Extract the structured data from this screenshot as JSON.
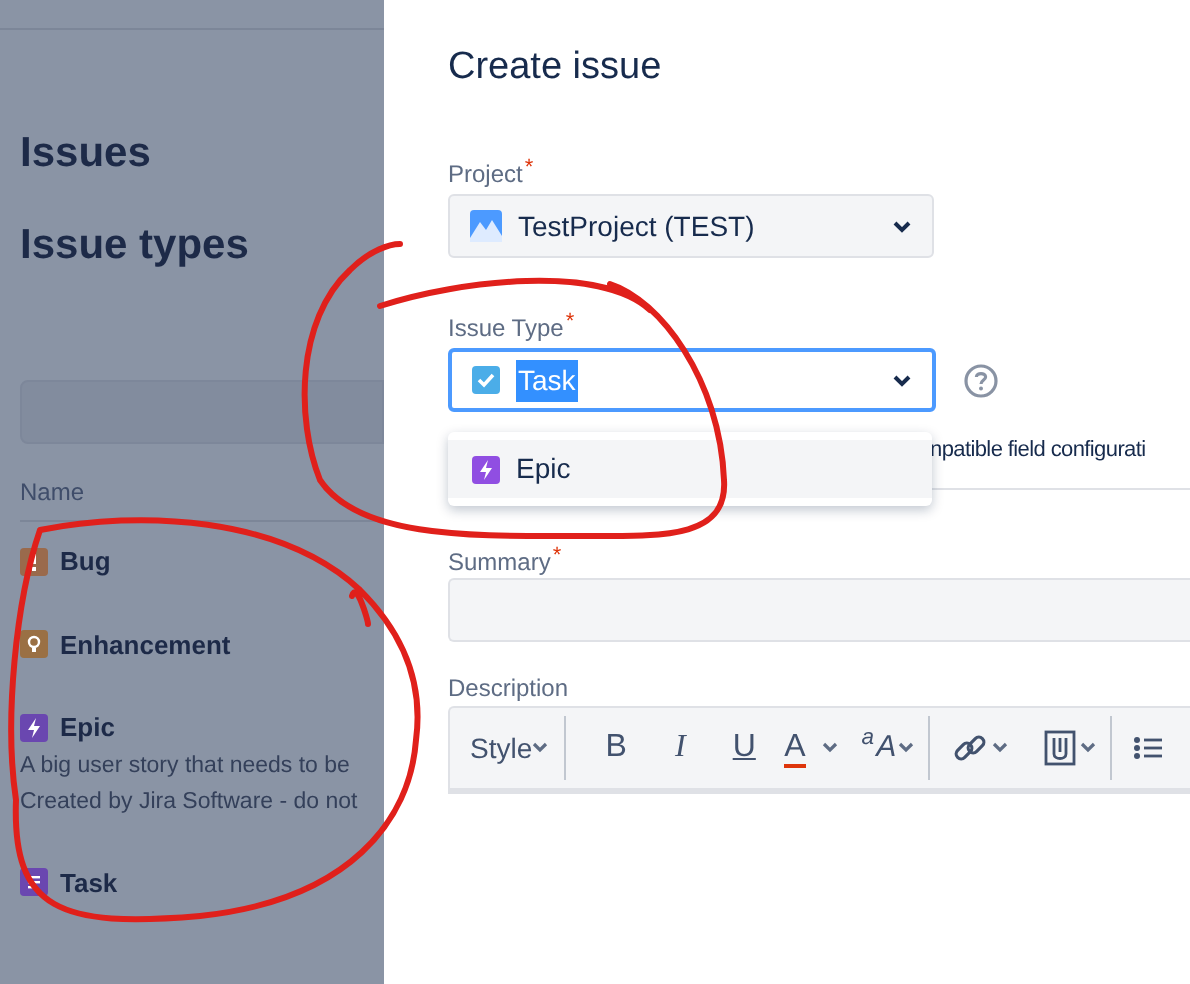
{
  "background": {
    "headings": [
      "Issues",
      "Issue types"
    ],
    "table": {
      "columns": [
        "Name"
      ],
      "rows": [
        {
          "kind": "bug",
          "name": "Bug",
          "color": "#9a6a4c"
        },
        {
          "kind": "enhancement",
          "name": "Enhancement",
          "color": "#9a7044"
        },
        {
          "kind": "epic",
          "name": "Epic",
          "color": "#6a47b0",
          "description": [
            "A big user story that needs to be",
            "Created by Jira Software - do not"
          ]
        },
        {
          "kind": "task",
          "name": "Task",
          "color": "#6a47b0"
        }
      ]
    }
  },
  "dialog": {
    "title": "Create issue",
    "project": {
      "label": "Project",
      "required_mark": "*",
      "value": "TestProject (TEST)"
    },
    "issue_type": {
      "label": "Issue Type",
      "required_mark": "*",
      "value": "Task",
      "focused": true,
      "options": [
        {
          "kind": "epic",
          "label": "Epic",
          "selected": false
        }
      ],
      "hidden_text": "npatible field configurati"
    },
    "summary": {
      "label": "Summary",
      "required_mark": "*"
    },
    "description": {
      "label": "Description",
      "toolbar": [
        {
          "kind": "style",
          "label": "Style"
        },
        {
          "kind": "bold",
          "label": "B"
        },
        {
          "kind": "italic",
          "label": "I"
        },
        {
          "kind": "underline",
          "label": "U"
        },
        {
          "kind": "color",
          "label": "A"
        },
        {
          "kind": "format",
          "label": "$^{a}$A"
        },
        {
          "kind": "link"
        },
        {
          "kind": "attachment"
        },
        {
          "kind": "list"
        }
      ]
    }
  }
}
